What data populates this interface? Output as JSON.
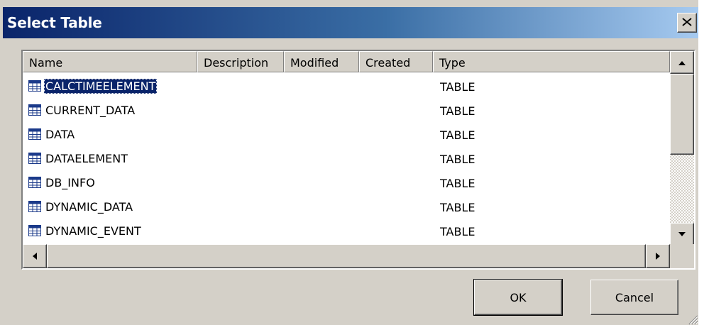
{
  "dialog": {
    "title": "Select Table"
  },
  "columns": [
    "Name",
    "Description",
    "Modified",
    "Created",
    "Type"
  ],
  "rows": [
    {
      "name": "CALCTIMEELEMENT",
      "type": "TABLE",
      "selected": true
    },
    {
      "name": "CURRENT_DATA",
      "type": "TABLE"
    },
    {
      "name": "DATA",
      "type": "TABLE"
    },
    {
      "name": "DATAELEMENT",
      "type": "TABLE"
    },
    {
      "name": "DB_INFO",
      "type": "TABLE"
    },
    {
      "name": "DYNAMIC_DATA",
      "type": "TABLE"
    },
    {
      "name": "DYNAMIC_EVENT",
      "type": "TABLE"
    }
  ],
  "buttons": {
    "ok": "OK",
    "cancel": "Cancel"
  },
  "icons": {
    "close": "close-icon",
    "table": "table-icon",
    "up": "arrow-up-icon",
    "down": "arrow-down-icon",
    "left": "arrow-left-icon",
    "right": "arrow-right-icon"
  },
  "colors": {
    "title_start": "#0a246a",
    "title_end": "#a6caf0",
    "selection": "#0a246a",
    "face": "#d4d0c8"
  }
}
